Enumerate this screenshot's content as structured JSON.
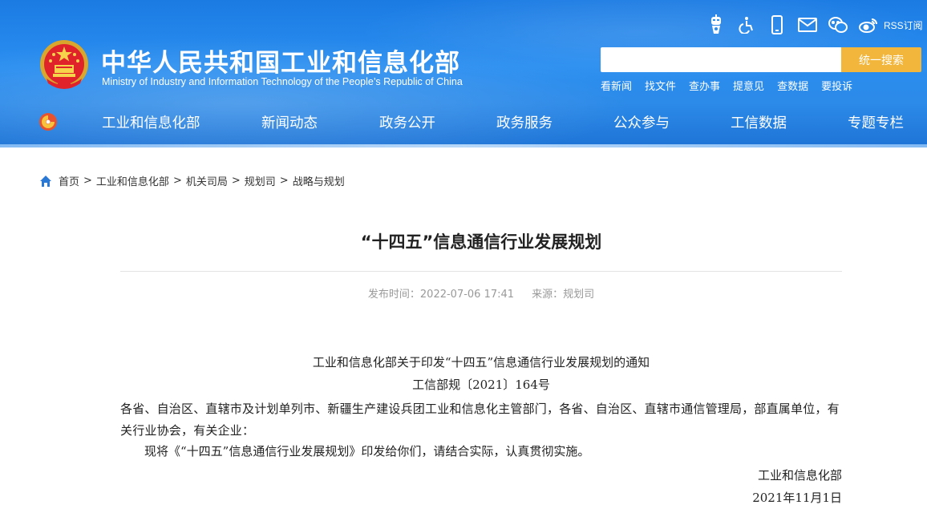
{
  "header": {
    "site_title": "中华人民共和国工业和信息化部",
    "site_subtitle": "Ministry of Industry and Information Technology of the People’s Republic of China",
    "top_icons": [
      "robot-icon",
      "accessibility-icon",
      "mobile-icon",
      "mail-icon",
      "wechat-icon",
      "weibo-icon"
    ],
    "rss_label": "RSS订阅",
    "search": {
      "placeholder": "",
      "value": "",
      "button_label": "统一搜索"
    },
    "quick_links": [
      "看新闻",
      "找文件",
      "查办事",
      "提意见",
      "查数据",
      "要投诉"
    ],
    "nav": [
      "工业和信息化部",
      "新闻动态",
      "政务公开",
      "政务服务",
      "公众参与",
      "工信数据",
      "专题专栏"
    ],
    "colors": {
      "banner": "#2a8ef0",
      "search_button": "#f2b63c"
    }
  },
  "breadcrumb": [
    "首页",
    "工业和信息化部",
    "机关司局",
    "规划司",
    "战略与规划"
  ],
  "article": {
    "title": "“十四五”信息通信行业发展规划",
    "publish_label": "发布时间：2022-07-06 17:41",
    "source_label": "来源：规划司",
    "notice_title": "工业和信息化部关于印发“十四五”信息通信行业发展规划的通知",
    "doc_number": "工信部规〔2021〕164号",
    "addressee": "各省、自治区、直辖市及计划单列市、新疆生产建设兵团工业和信息化主管部门，各省、自治区、直辖市通信管理局，部直属单位，有关行业协会，有关企业：",
    "paragraph": "现将《“十四五”信息通信行业发展规划》印发给你们，请结合实际，认真贯彻实施。",
    "signature": "工业和信息化部",
    "date": "2021年11月1日"
  }
}
